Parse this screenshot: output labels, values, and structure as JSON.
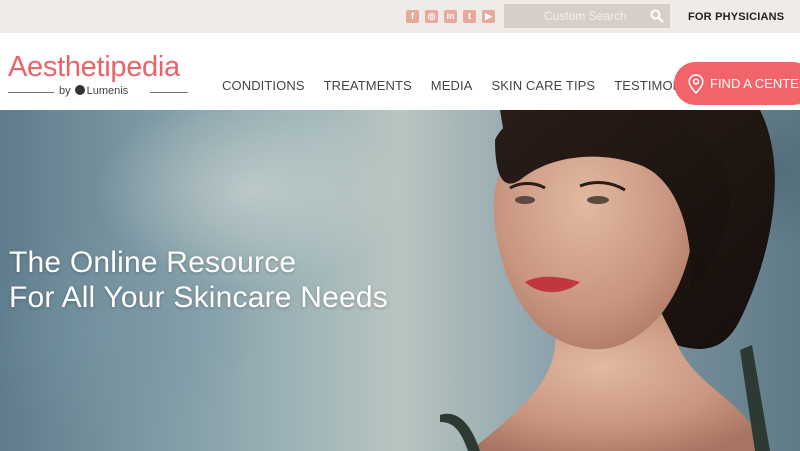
{
  "topbar": {
    "social_icons": [
      "facebook-icon",
      "instagram-icon",
      "linkedin-icon",
      "twitter-icon",
      "youtube-icon"
    ],
    "search_placeholder": "Custom Search",
    "physicians_link": "FOR PHYSICIANS"
  },
  "header": {
    "brand": "Aesthetipedia",
    "byline_by": "by",
    "byline_company": "Lumenis",
    "nav": [
      "CONDITIONS",
      "TREATMENTS",
      "MEDIA",
      "SKIN CARE TIPS",
      "TESTIMONIALS"
    ],
    "cta": "FIND A CENTER"
  },
  "hero": {
    "line1": "The Online Resource",
    "line2": "For All Your Skincare Needs"
  },
  "colors": {
    "brand": "#e9646a",
    "cta": "#f0646a",
    "topbar_bg": "#f1ebe7",
    "search_bg": "#d6cec8"
  }
}
